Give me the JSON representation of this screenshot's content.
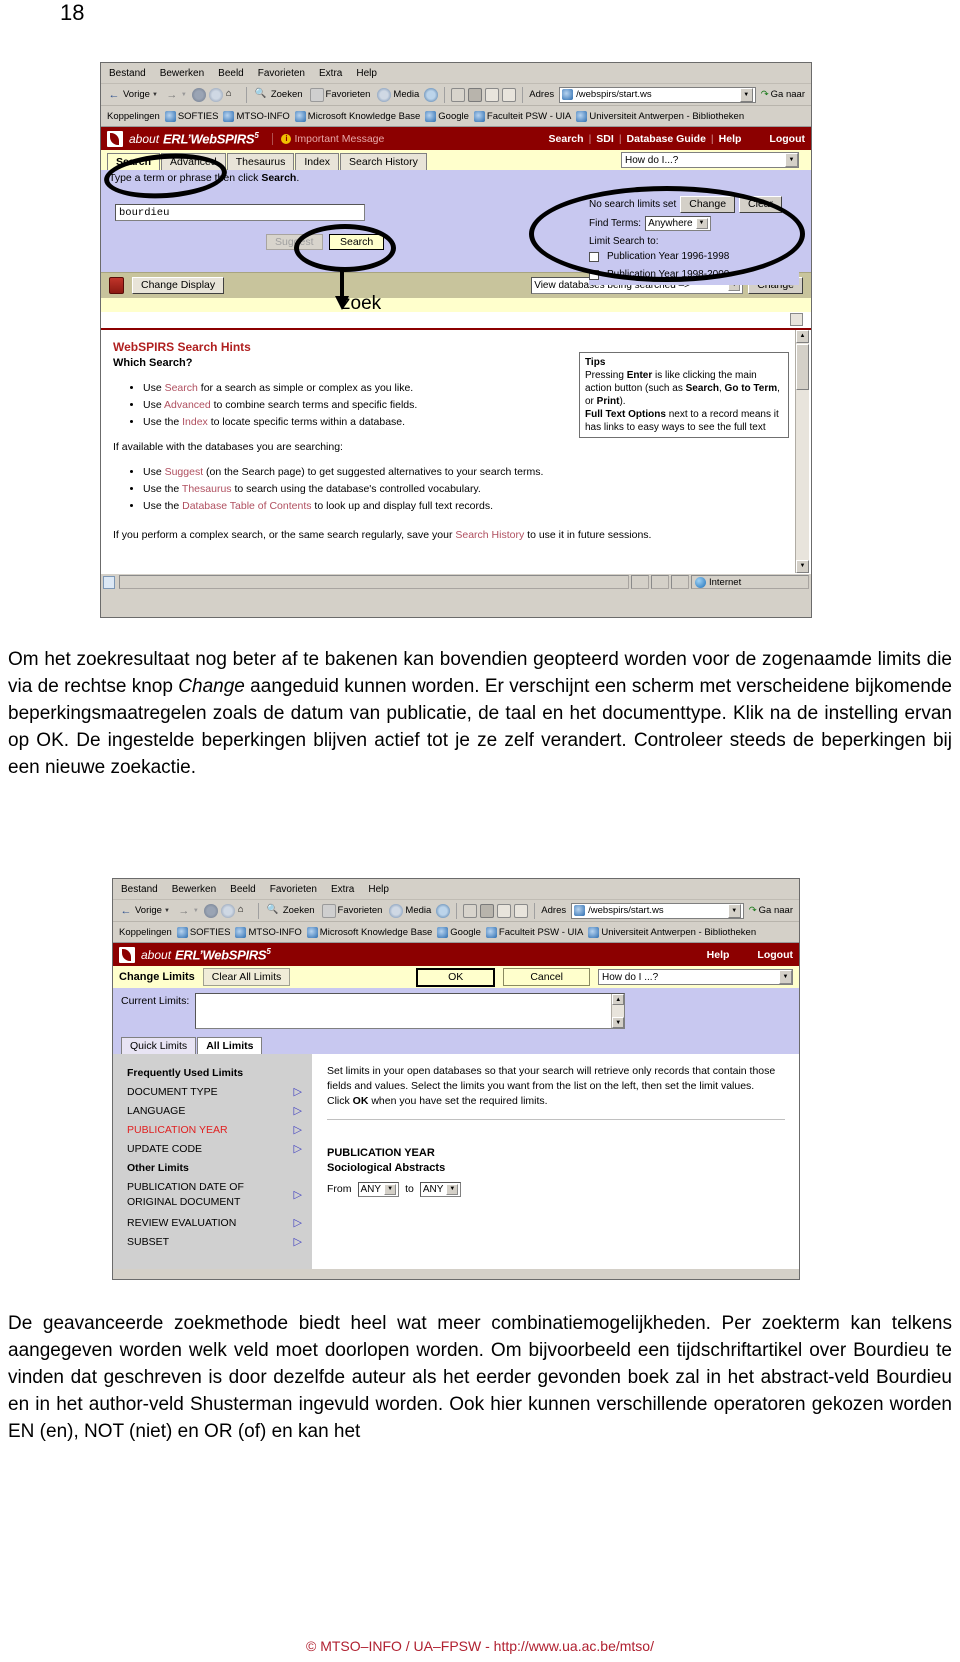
{
  "page": {
    "number": "18"
  },
  "browser_chrome": {
    "menu": [
      "Bestand",
      "Bewerken",
      "Beeld",
      "Favorieten",
      "Extra",
      "Help"
    ],
    "toolbar": {
      "back": "Vorige",
      "search": "Zoeken",
      "favorites": "Favorieten",
      "media": "Media",
      "address_label": "Adres",
      "address_value": "/webspirs/start.ws",
      "go": "Ga naar"
    },
    "links": {
      "label": "Koppelingen",
      "items": [
        "SOFTIES",
        "MTSO-INFO",
        "Microsoft Knowledge Base",
        "Google",
        "Faculteit PSW - UIA",
        "Universiteit Antwerpen - Bibliotheken"
      ]
    },
    "status": {
      "zone": "Internet"
    }
  },
  "screenshot1": {
    "banner": {
      "about": "about",
      "product": "ERL’WebSPIRS",
      "version": "5",
      "message": "Important Message",
      "nav": [
        "Search",
        "SDI",
        "Database Guide",
        "Help",
        "Logout"
      ]
    },
    "tabs": [
      {
        "label": "Search",
        "active": true
      },
      {
        "label": "Advanced",
        "active": false
      },
      {
        "label": "Thesaurus",
        "active": false
      },
      {
        "label": "Index",
        "active": false
      },
      {
        "label": "Search History",
        "active": false
      }
    ],
    "help_dropdown": "How do I...?",
    "instruction": "Type a term or phrase then click Search.",
    "instruction_bold": "Search",
    "search": {
      "value": "bourdieu",
      "suggest_label": "Suggest",
      "search_label": "Search"
    },
    "limits": {
      "status": "No search limits set",
      "change_label": "Change",
      "clear_label": "Clear",
      "find_terms_label": "Find Terms:",
      "find_terms_value": "Anywhere",
      "limit_to_label": "Limit Search to:",
      "options": [
        {
          "label": "Publication Year 1996-1998",
          "checked": false
        },
        {
          "label": "Publication Year 1998-2000",
          "checked": false
        }
      ]
    },
    "actionbar": {
      "change_display": "Change Display",
      "databases_value": "View databases being searched –>",
      "change_label": "Change"
    },
    "hints": {
      "title": "WebSPIRS Search Hints",
      "subtitle": "Which Search?",
      "list1": [
        {
          "pre": "Use ",
          "kw": "Search",
          "post": " for a search as simple or complex as you like."
        },
        {
          "pre": "Use ",
          "kw": "Advanced",
          "post": " to combine search terms and specific fields."
        },
        {
          "pre": "Use the ",
          "kw": "Index",
          "post": " to locate specific terms within a database."
        }
      ],
      "mid_line": "If available with the databases you are searching:",
      "list2": [
        {
          "pre": "Use ",
          "kw": "Suggest",
          "post": " (on the Search page) to get suggested alternatives to your search terms."
        },
        {
          "pre": "Use the ",
          "kw": "Thesaurus",
          "post": " to search using the database's controlled vocabulary."
        },
        {
          "pre": "Use the ",
          "kw": "Database Table of Contents",
          "post": " to look up and display full text records."
        }
      ],
      "final_pre": "If you perform a complex search, or the same search regularly, save your ",
      "final_kw": "Search History",
      "final_post": " to use it in future sessions."
    },
    "tips": {
      "title": "Tips",
      "line1_a": "Pressing ",
      "line1_b": "Enter",
      "line1_c": " is like clicking the main action button (such as ",
      "line1_d": "Search",
      "line1_e": ", ",
      "line1_f": "Go to Term",
      "line1_g": ", or ",
      "line1_h": "Print",
      "line1_i": ").",
      "line2_a": "Full Text Options",
      "line2_b": " next to a record means it has links to easy ways to see the full text"
    },
    "annotation": {
      "zoek_label": "zoek"
    }
  },
  "paragraph1": {
    "part1": "Om het zoekresultaat nog beter af te bakenen kan bovendien geopteerd worden voor de zogenaamde limits die via de rechtse knop ",
    "emph": "Change",
    "part2": " aangeduid kunnen worden. Er verschijnt een scherm met verscheidene bijkomende beperkingsmaatregelen zoals de datum van publicatie, de taal en het documenttype. Klik na de instelling ervan op OK. De ingestelde beperkingen blijven actief tot je ze zelf verandert. Controleer steeds de beperkingen bij een nieuwe zoekactie."
  },
  "screenshot2": {
    "banner": {
      "about": "about",
      "product": "ERL’WebSPIRS",
      "version": "5",
      "nav": [
        "Help",
        "Logout"
      ]
    },
    "toolbar": {
      "title": "Change Limits",
      "clear_all": "Clear All Limits",
      "ok": "OK",
      "cancel": "Cancel",
      "help_dropdown": "How do I ...?"
    },
    "current_limits_label": "Current Limits:",
    "current_limits_value": "",
    "tabs": [
      {
        "label": "Quick Limits",
        "active": false
      },
      {
        "label": "All Limits",
        "active": true
      }
    ],
    "left_panel": {
      "group1_title": "Frequently Used Limits",
      "group1_items": [
        {
          "label": "DOCUMENT TYPE",
          "highlight": false
        },
        {
          "label": "LANGUAGE",
          "highlight": false
        },
        {
          "label": "PUBLICATION YEAR",
          "highlight": true
        },
        {
          "label": "UPDATE CODE",
          "highlight": false
        }
      ],
      "group2_title": "Other Limits",
      "group2_items": [
        {
          "label": "PUBLICATION DATE OF ORIGINAL DOCUMENT",
          "highlight": false
        },
        {
          "label": "REVIEW EVALUATION",
          "highlight": false
        },
        {
          "label": "SUBSET",
          "highlight": false
        }
      ]
    },
    "right_panel": {
      "intro1": "Set limits in your open databases so that your search will retrieve only records that contain those fields and values. Select the limits you want from the list on the left, then set the limit values.",
      "intro2_a": "Click ",
      "intro2_b": "OK",
      "intro2_c": " when you have set the required limits.",
      "field_title": "PUBLICATION YEAR",
      "database": "Sociological Abstracts",
      "from_label": "From",
      "from_value": "ANY",
      "to_label": "to",
      "to_value": "ANY"
    }
  },
  "paragraph2": "De geavanceerde zoekmethode biedt heel wat meer combinatiemogelijkheden. Per zoekterm kan telkens aangegeven worden welk veld moet doorlopen worden. Om bijvoorbeeld een tijdschriftartikel over Bourdieu te vinden dat geschreven is door dezelfde auteur als het eerder gevonden boek zal in het abstract-veld Bourdieu en in het author-veld Shusterman ingevuld worden. Ook hier kunnen verschillende operatoren gekozen worden EN (en), NOT (niet) en OR (of) en kan het",
  "footer": "© MTSO–INFO / UA–FPSW -  http://www.ua.ac.be/mtso/"
}
